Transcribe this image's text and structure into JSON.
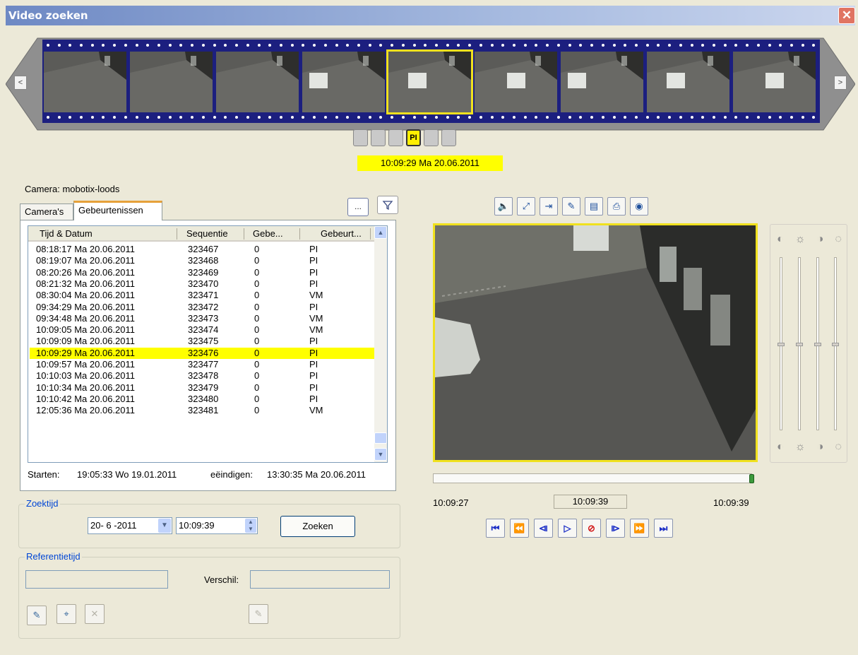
{
  "window": {
    "title": "Video zoeken",
    "close_icon": "close-icon"
  },
  "filmstrip": {
    "frames": [
      "frame-1",
      "frame-2",
      "frame-3",
      "frame-4",
      "frame-5",
      "frame-6",
      "frame-7",
      "frame-8",
      "frame-9"
    ],
    "selected_index": 4,
    "left_arrow": "<",
    "right_arrow": ">"
  },
  "event_markers": {
    "labels": [
      "",
      "",
      "",
      "PI",
      "",
      ""
    ],
    "active_index": 3
  },
  "timestamp": "10:09:29 Ma 20.06.2011",
  "camera_label": "Camera: mobotix-loods",
  "buttons": {
    "more": "...",
    "filter": "filter-icon"
  },
  "tabs": [
    {
      "label": "Camera's"
    },
    {
      "label": "Gebeurtenissen"
    }
  ],
  "list": {
    "headers": [
      "Tijd & Datum",
      "Sequentie",
      "Gebe...",
      "Gebeurt..."
    ],
    "rows": [
      [
        "08:18:17 Ma 20.06.2011",
        "323467",
        "0",
        "PI"
      ],
      [
        "08:19:07 Ma 20.06.2011",
        "323468",
        "0",
        "PI"
      ],
      [
        "08:20:26 Ma 20.06.2011",
        "323469",
        "0",
        "PI"
      ],
      [
        "08:21:32 Ma 20.06.2011",
        "323470",
        "0",
        "PI"
      ],
      [
        "08:30:04 Ma 20.06.2011",
        "323471",
        "0",
        "VM"
      ],
      [
        "09:34:29 Ma 20.06.2011",
        "323472",
        "0",
        "PI"
      ],
      [
        "09:34:48 Ma 20.06.2011",
        "323473",
        "0",
        "VM"
      ],
      [
        "10:09:05 Ma 20.06.2011",
        "323474",
        "0",
        "VM"
      ],
      [
        "10:09:09 Ma 20.06.2011",
        "323475",
        "0",
        "PI"
      ],
      [
        "10:09:29 Ma 20.06.2011",
        "323476",
        "0",
        "PI"
      ],
      [
        "10:09:57 Ma 20.06.2011",
        "323477",
        "0",
        "PI"
      ],
      [
        "10:10:03 Ma 20.06.2011",
        "323478",
        "0",
        "PI"
      ],
      [
        "10:10:34 Ma 20.06.2011",
        "323479",
        "0",
        "PI"
      ],
      [
        "10:10:42 Ma 20.06.2011",
        "323480",
        "0",
        "PI"
      ],
      [
        "12:05:36 Ma 20.06.2011",
        "323481",
        "0",
        "VM"
      ]
    ],
    "selected_row": 9
  },
  "range": {
    "start_label": "Starten:",
    "start_value": "19:05:33 Wo 19.01.2011",
    "end_label": "eëindigen:",
    "end_value": "13:30:35 Ma 20.06.2011"
  },
  "zoektijd": {
    "legend": "Zoektijd",
    "date_value": "20- 6 -2011",
    "time_value": "10:09:39",
    "search_button": "Zoeken"
  },
  "referentietijd": {
    "legend": "Referentietijd",
    "ref_value": "",
    "diff_label": "Verschil:",
    "diff_value": ""
  },
  "player": {
    "toolbar_icons": [
      "speaker-icon",
      "fullscreen-icon",
      "export-clip-icon",
      "edit-icon",
      "save-icon",
      "print-icon",
      "record-icon"
    ],
    "start_time": "10:09:27",
    "current_time": "10:09:39",
    "end_time": "10:09:39",
    "progress": 1.0,
    "transport_icons": [
      "first-icon",
      "rewind-icon",
      "step-back-icon",
      "play-icon",
      "stop-icon",
      "step-forward-icon",
      "fast-forward-icon",
      "last-icon"
    ]
  },
  "image_adjust": {
    "icons": [
      "contrast-icon",
      "brightness-icon",
      "saturation-icon",
      "gamma-icon"
    ],
    "levels": [
      0.5,
      0.5,
      0.5,
      0.5
    ]
  },
  "colors": {
    "highlight": "#ffff00",
    "filmstrip": "#1c1f7f",
    "accent_legend": "#0046d5"
  }
}
